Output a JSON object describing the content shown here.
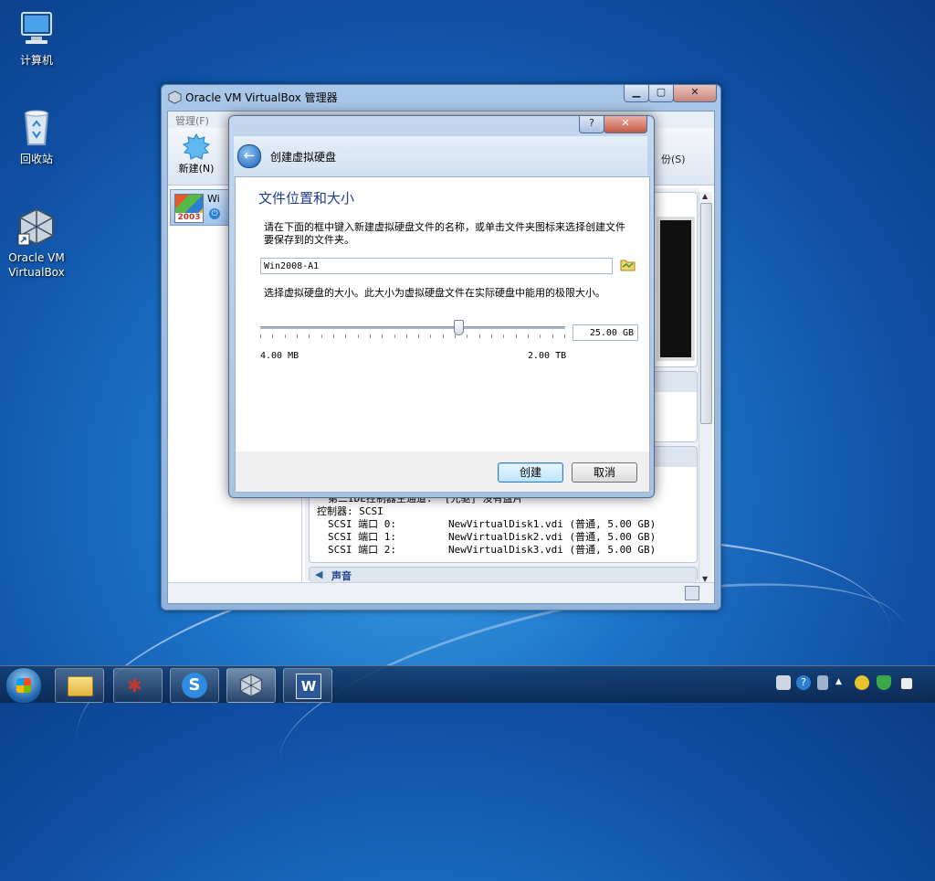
{
  "desktop": {
    "icons": [
      {
        "label": "计算机",
        "icon": "computer-icon"
      },
      {
        "label": "回收站",
        "icon": "recycle-bin-icon"
      },
      {
        "label": "Oracle VM VirtualBox",
        "icon": "virtualbox-icon"
      }
    ]
  },
  "vbox_window": {
    "title": "Oracle VM VirtualBox 管理器",
    "menu": [
      "管理(F)"
    ],
    "toolbar": {
      "new_label": "新建(N)",
      "right_label": "份(S)"
    },
    "vm_item": {
      "os_badge": "2003",
      "name": "Wi"
    },
    "storage": {
      "line_ide": "第二IDE控制器主通道:  [光驱] 没有盘片",
      "controller": "控制器: SCSI",
      "disks": [
        {
          "port": "SCSI 端口 0:",
          "value": "NewVirtualDisk1.vdi (普通, 5.00 GB)"
        },
        {
          "port": "SCSI 端口 1:",
          "value": "NewVirtualDisk2.vdi (普通, 5.00 GB)"
        },
        {
          "port": "SCSI 端口 2:",
          "value": "NewVirtualDisk3.vdi (普通, 5.00 GB)"
        }
      ],
      "next_section": "声音"
    }
  },
  "dialog": {
    "title": "创建虚拟硬盘",
    "heading": "文件位置和大小",
    "instruction1": "请在下面的框中键入新建虚拟硬盘文件的名称，或单击文件夹图标来选择创建文件要保存到的文件夹。",
    "filename": "Win2008-A1",
    "instruction2": "选择虚拟硬盘的大小。此大小为虚拟硬盘文件在实际硬盘中能用的极限大小。",
    "size_value": "25.00 GB",
    "slider_min": "4.00 MB",
    "slider_max": "2.00 TB",
    "slider_fraction": 0.65,
    "create_button": "创建",
    "cancel_button": "取消",
    "help_button": "?",
    "close_button": "✕"
  },
  "colors": {
    "accent": "#1c5fb3",
    "heading": "#1e3f8f"
  }
}
